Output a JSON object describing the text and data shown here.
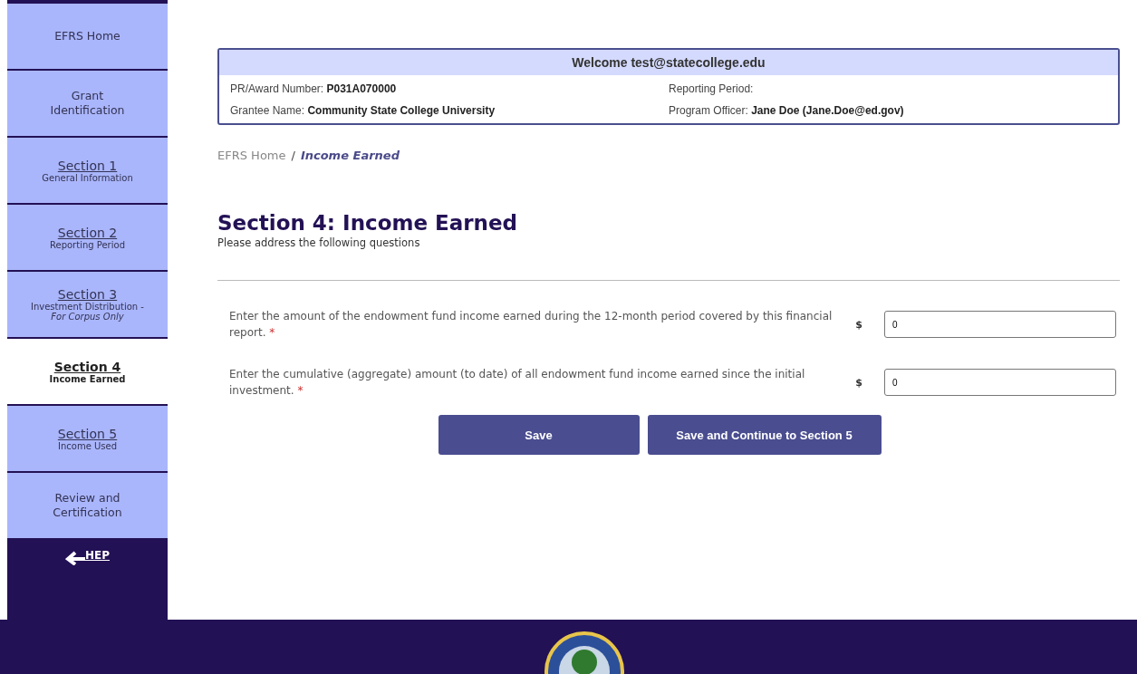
{
  "sidebar": {
    "items": [
      {
        "kind": "plain",
        "title": "EFRS Home",
        "selected": false
      },
      {
        "kind": "plain",
        "title": "Grant Identification",
        "selected": false
      },
      {
        "kind": "section",
        "title": "Section 1",
        "subtitle": "General Information",
        "selected": false
      },
      {
        "kind": "section",
        "title": "Section 2",
        "subtitle": "Reporting Period",
        "selected": false
      },
      {
        "kind": "section",
        "title": "Section 3",
        "subtitle": "Investment Distribution -",
        "note": "For Corpus Only",
        "selected": false
      },
      {
        "kind": "section",
        "title": "Section 4",
        "subtitle": "Income Earned",
        "selected": true
      },
      {
        "kind": "section",
        "title": "Section 5",
        "subtitle": "Income Used",
        "selected": false
      },
      {
        "kind": "plain",
        "title": "Review and Certification",
        "selected": false
      }
    ],
    "back_link": "HEP"
  },
  "info_box": {
    "title": "Welcome test@statecollege.edu",
    "fields": [
      {
        "label": "PR/Award Number:",
        "value": "P031A070000"
      },
      {
        "label": "Reporting Period:"
      },
      {
        "label": "Grantee Name:",
        "value": "Community State College University"
      },
      {
        "label": "Program Officer:",
        "value": "Jane Doe (Jane.Doe@ed.gov)"
      }
    ]
  },
  "breadcrumb": {
    "home": "EFRS Home",
    "separator": "/",
    "current": "Income Earned"
  },
  "heading": "Section 4: Income Earned",
  "subheading": "Please address the following questions",
  "questions": [
    {
      "text": "Enter the amount of the endowment fund income earned during the 12-month period covered by this financial report.",
      "required_mark": "*",
      "currency": "$",
      "value": "0"
    },
    {
      "text": "Enter the cumulative (aggregate) amount (to date) of all endowment fund income earned since the initial investment.",
      "required_mark": "*",
      "currency": "$",
      "value": "0"
    }
  ],
  "buttons": [
    "Save",
    "Save and Continue to Section 5"
  ]
}
